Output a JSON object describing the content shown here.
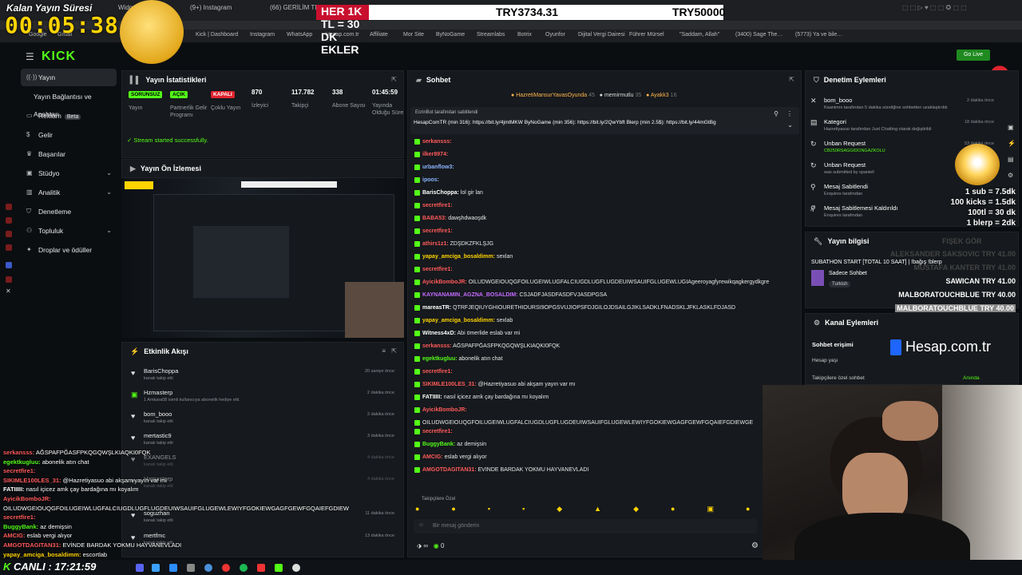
{
  "browser": {
    "tabs": [
      "Widg…",
      "(9+) Instagram",
      "(66) GERİLİM TIRM",
      "(4) X"
    ],
    "bookmarks": [
      "Google",
      "Gmail",
      "Kick | Dashboard",
      "Instagram",
      "WhatsApp",
      "Hesap.com.tr",
      "Affiliate",
      "Mor Site",
      "ByNoGame",
      "Streamlabs",
      "Botrix",
      "Oyunfor",
      "Dijital Vergi Dairesi",
      "Führer Mürsel",
      "\"Saddam, Allah\"",
      "(3400) Sage The…",
      "(5773) Ya ve bile…"
    ]
  },
  "overlay": {
    "timer_label": "Kalan Yayın Süresi",
    "timer": "00:05:38",
    "goal_prefix": "HER 1K TL = 30 DK EKLER",
    "goal_current": "TRY3734.31",
    "goal_target": "TRY50000",
    "live_label": "CANLI :",
    "clock": "17:21:59",
    "donation_rates": [
      "1 sub = 7.5dk",
      "100 kicks = 1.5dk",
      "100tl = 30 dk",
      "1 blerp = 2dk"
    ],
    "top_donors": [
      {
        "name": "ALEKSANDER SAKSOVIC",
        "amount": "TRY 41.00"
      },
      {
        "name": "MUSTAFA KANTER",
        "amount": "TRY 41.00"
      },
      {
        "name": "SAWICAN",
        "amount": "TRY 41.00"
      },
      {
        "name": "MALBORATOUCHBLUE",
        "amount": "TRY 40.00"
      },
      {
        "name": "MALBORATOUCHBLUE",
        "amount": "TRY 40.00"
      }
    ],
    "fisek": "FIŞEK GÖR",
    "sponsor": "Hesap.com.tr",
    "go_live": "Go Live",
    "chat_lines": [
      {
        "user": "serkansss:",
        "text": "AĞSPAFPĞASFPKQGQWŞLKIAQKI0FQK",
        "color": "#ff5a5a"
      },
      {
        "user": "egektkugluu:",
        "text": "abonelik atın chat",
        "color": "#53fc18"
      },
      {
        "user": "secretfire1:",
        "text": "",
        "color": "#ff5a5a"
      },
      {
        "user": "SIKIMLE100LES_31:",
        "text": "@Hazretiyasuo abi akşam yayın var mı",
        "color": "#ff5a5a"
      },
      {
        "user": "FATIIIII:",
        "text": "nasıl içicez amk çay bardağına mı koyalım",
        "color": "#ffffff"
      },
      {
        "user": "AyicikBomboJR:",
        "text": "",
        "color": "#ff5a5a"
      },
      {
        "user": "",
        "text": "OILUDWGEIOUQGFOILUGEIWLUGFALCIUGDLUGFLUGDEUIWSAUIFGLUGEWLEWIYFGOKIEWGAGFGEWFGQAIEFGDIEW",
        "color": "#ffffff"
      },
      {
        "user": "secretfire1:",
        "text": "",
        "color": "#ff5a5a"
      },
      {
        "user": "BuggyBank:",
        "text": "az demişsin",
        "color": "#53fc18"
      },
      {
        "user": "AMCIG:",
        "text": "eslab vergi alıyor",
        "color": "#ff5a5a"
      },
      {
        "user": "AMGOTDAGITAN31:",
        "text": "EVİNDE BARDAK YOKMU HAYVANEVLADI",
        "color": "#ff5a5a"
      },
      {
        "user": "yapay_amciga_bosaldimm:",
        "text": "escortlab",
        "color": "#ffd400"
      }
    ]
  },
  "sidebar": {
    "logo": "KICK",
    "items": [
      {
        "label": "Yayın",
        "icon": "broadcast-icon",
        "active": true
      },
      {
        "label": "Yayın Bağlantısı ve Anahtarı",
        "icon": "key-icon"
      },
      {
        "label": "Reklam",
        "badge": "Beta",
        "icon": "ad-icon"
      },
      {
        "label": "Gelir",
        "icon": "money-icon"
      },
      {
        "label": "Başarılar",
        "icon": "trophy-icon"
      },
      {
        "label": "Stüdyo",
        "icon": "studio-icon",
        "chevron": true
      },
      {
        "label": "Analitik",
        "icon": "analytics-icon",
        "chevron": true
      },
      {
        "label": "Denetleme",
        "icon": "shield-icon"
      },
      {
        "label": "Topluluk",
        "icon": "community-icon",
        "chevron": true
      },
      {
        "label": "Droplar ve ödüller",
        "icon": "gift-icon"
      }
    ]
  },
  "stats": {
    "title": "Yayın İstatistikleri",
    "items": [
      {
        "value": "SORUNSUZ",
        "label": "Yayın",
        "badge": "green"
      },
      {
        "value": "AÇIK",
        "label": "Partnerlik Gelir Programı",
        "badge": "green"
      },
      {
        "value": "KAPALI",
        "label": "Çoklu Yayın",
        "badge": "red"
      },
      {
        "value": "870",
        "label": "İzleyici"
      },
      {
        "value": "117.782",
        "label": "Takipçi"
      },
      {
        "value": "338",
        "label": "Abone Sayısı"
      },
      {
        "value": "01:45:59",
        "label": "Yayında Olduğu Süre"
      }
    ],
    "success": "Stream started successfully."
  },
  "preview": {
    "title": "Yayın Ön İzlemesi"
  },
  "activity": {
    "title": "Etkinlik Akışı",
    "items": [
      {
        "name": "BarisChoppa",
        "sub": "kanalı takip etti",
        "time": "20 saniye önce",
        "icon": "heart-icon"
      },
      {
        "name": "Hzmasterp",
        "sub": "1 Amkara08 isimli kullanıcıya abonelik hediye etti.",
        "time": "2 dakika önce",
        "icon": "gift-icon"
      },
      {
        "name": "bom_booo",
        "sub": "kanalı takip etti",
        "time": "2 dakika önce",
        "icon": "heart-icon"
      },
      {
        "name": "mertastic9",
        "sub": "kanalı takip etti",
        "time": "3 dakika önce",
        "icon": "heart-icon"
      },
      {
        "name": "EXANGELS",
        "sub": "kanalı takip etti",
        "time": "4 dakika önce",
        "icon": "heart-icon"
      },
      {
        "name": "Hzmasterp",
        "sub": "kanalı takip etti",
        "time": "4 dakika önce",
        "icon": "heart-icon"
      },
      {
        "name": "soguzhan",
        "sub": "kanalı takip etti",
        "time": "11 dakika önce",
        "icon": "heart-icon"
      },
      {
        "name": "mertfmc",
        "sub": "kanalı takip etti",
        "time": "13 dakika önce",
        "icon": "heart-icon"
      }
    ]
  },
  "chat": {
    "title": "Sohbet",
    "top_gifters": [
      {
        "name": "HazretiMansurYavasOyunda",
        "count": "45"
      },
      {
        "name": "memirmutlu",
        "count": "35"
      },
      {
        "name": "Ayakk3",
        "count": "16"
      }
    ],
    "pinned_by": "EcrinBot tarafından sabitlendi",
    "pinned_text": "HesapComTR (min 316): https://bit.ly/4jmtMKW ByNoGame (min 356): https://bit.ly/2QwYbft Blerp (min 2.5$): https://bit.ly/44mGtBg",
    "messages": [
      {
        "user": "serkansss:",
        "text": "",
        "color": "#ff5a5a"
      },
      {
        "user": "ilker8974:",
        "text": "",
        "color": "#ff5a5a"
      },
      {
        "user": "urbanflow3:",
        "text": "",
        "color": "#8ab4ff"
      },
      {
        "user": "ipoos:",
        "text": "",
        "color": "#8ab4ff"
      },
      {
        "user": "BarisChoppa:",
        "text": "lol gir lan",
        "color": "#ffffff"
      },
      {
        "user": "secretfire1:",
        "text": "",
        "color": "#ff5a5a"
      },
      {
        "user": "BABA53:",
        "text": "dawşhdwaoşdk",
        "color": "#ff5a5a"
      },
      {
        "user": "secretfire1:",
        "text": "",
        "color": "#ff5a5a"
      },
      {
        "user": "athirs1z1:",
        "text": "ZDŞDKZFKLŞJG",
        "color": "#ff5a5a"
      },
      {
        "user": "yapay_amciga_bosaldimm:",
        "text": "sexlan",
        "color": "#ffd400"
      },
      {
        "user": "secretfire1:",
        "text": "",
        "color": "#ff5a5a"
      },
      {
        "user": "AyicikBomboJR:",
        "text": "OILUDWGEIOUQGFOILUGEIWLUGFALCIUGDLUGFLUGDEUIWSAUIFGLUGEWLUGIAgeeroyagfyrewikqagkergydkgre",
        "color": "#ff5a5a"
      },
      {
        "user": "KAYNANAMIN_AGZNA_BOSALDIM:",
        "text": "CSJADFJASDFASDFVJASDPGSA",
        "color": "#c46bff"
      },
      {
        "user": "mareasTR:",
        "text": "QTRFJEQIUYGHIOURETHIOURSI9OPGSVUJIOPSFDJGILOJDSAILGJIKLSADKLFNADSKLJFKLASKLFDJASD",
        "color": "#ffffff"
      },
      {
        "user": "yapay_amciga_bosaldimm:",
        "text": "sexlab",
        "color": "#ffd400"
      },
      {
        "user": "Witness4xD:",
        "text": "Abi ömerlide eslab var mi",
        "color": "#ffffff"
      },
      {
        "user": "serkansss:",
        "text": "AĞSPAFPĞASFPKQGQWŞLKIAQKI0FQK",
        "color": "#ff5a5a"
      },
      {
        "user": "egektkugluu:",
        "text": "abonelik atın chat",
        "color": "#53fc18"
      },
      {
        "user": "secretfire1:",
        "text": "",
        "color": "#ff5a5a"
      },
      {
        "user": "SIKIMLE100LES_31:",
        "text": "@Hazretiyasuo abi akşam yayın var mı",
        "color": "#ff5a5a"
      },
      {
        "user": "FATIIIII:",
        "text": "nasıl içicez amk çay bardağına mı koyalım",
        "color": "#ffffff"
      },
      {
        "user": "AyicikBomboJR:",
        "text": "",
        "color": "#ff5a5a"
      },
      {
        "user": "",
        "text": "OILUDWGEIOUQGFOILUGEIWLUGFALCIUGDLUGFLUGDEUIWSAUIFGLUGEWLEWIYFGOKIEWGAGFGEWFGQAIEFGDIEWGE",
        "color": "#ffffff"
      },
      {
        "user": "secretfire1:",
        "text": "",
        "color": "#ff5a5a"
      },
      {
        "user": "BuggyBank:",
        "text": "az demişsin",
        "color": "#53fc18"
      },
      {
        "user": "AMCIG:",
        "text": "eslab vergi alıyor",
        "color": "#ff5a5a"
      },
      {
        "user": "AMGOTDAGITAN31:",
        "text": "EVİNDE BARDAK YOKMU HAYVANEVLADI",
        "color": "#ff5a5a"
      },
      {
        "user": "yapay_amciga_bosaldimm:",
        "text": "escortlab",
        "color": "#ffd400"
      }
    ],
    "followers_label": "Takipçilere Özel",
    "input_placeholder": "Bir mesaj gönderin",
    "viewer_count": "0"
  },
  "moderation": {
    "title": "Denetim Eylemleri",
    "items": [
      {
        "title": "bom_booo",
        "desc": "Kaanimrs tarafından 5 dakika süreliğine sohbetten uzaklaştırıldı",
        "time": "2 dakika önce",
        "icon": "x-icon"
      },
      {
        "title": "Kategori",
        "desc": "Hazretiyasuo tarafından Just Chatting olarak değiştirildi",
        "time": "18 dakika önce",
        "icon": "folder-icon"
      },
      {
        "title": "Unban Request",
        "desc": "CB250RSAGGIDONGAZKOLU",
        "time": "53 dakika önce",
        "icon": "refresh-icon"
      },
      {
        "title": "Unban Request",
        "desc": "was submitted by spaniell",
        "time": "",
        "icon": "refresh-icon"
      },
      {
        "title": "Mesaj Sabitlendi",
        "desc": "Enquires tarafından",
        "time": "",
        "icon": "pin-icon"
      },
      {
        "title": "Mesaj Sabitlemesi Kaldırıldı",
        "desc": "Enquires tarafından",
        "time": "",
        "icon": "unpin-icon"
      }
    ]
  },
  "stream_info": {
    "title": "Yayın bilgisi",
    "stream_title": "SUBATHON START [TOTAL 10 SAAT] | !bağış !blerp",
    "category": "Sadece Sohbet",
    "language": "Turkish"
  },
  "channel_actions": {
    "title": "Kanal Eylemleri",
    "chat_access": "Sohbet erişimi",
    "account_age": "Hesap yaşı",
    "followers_only": "Takipçilere özel sohbet",
    "followers_only_value": "Anında"
  }
}
